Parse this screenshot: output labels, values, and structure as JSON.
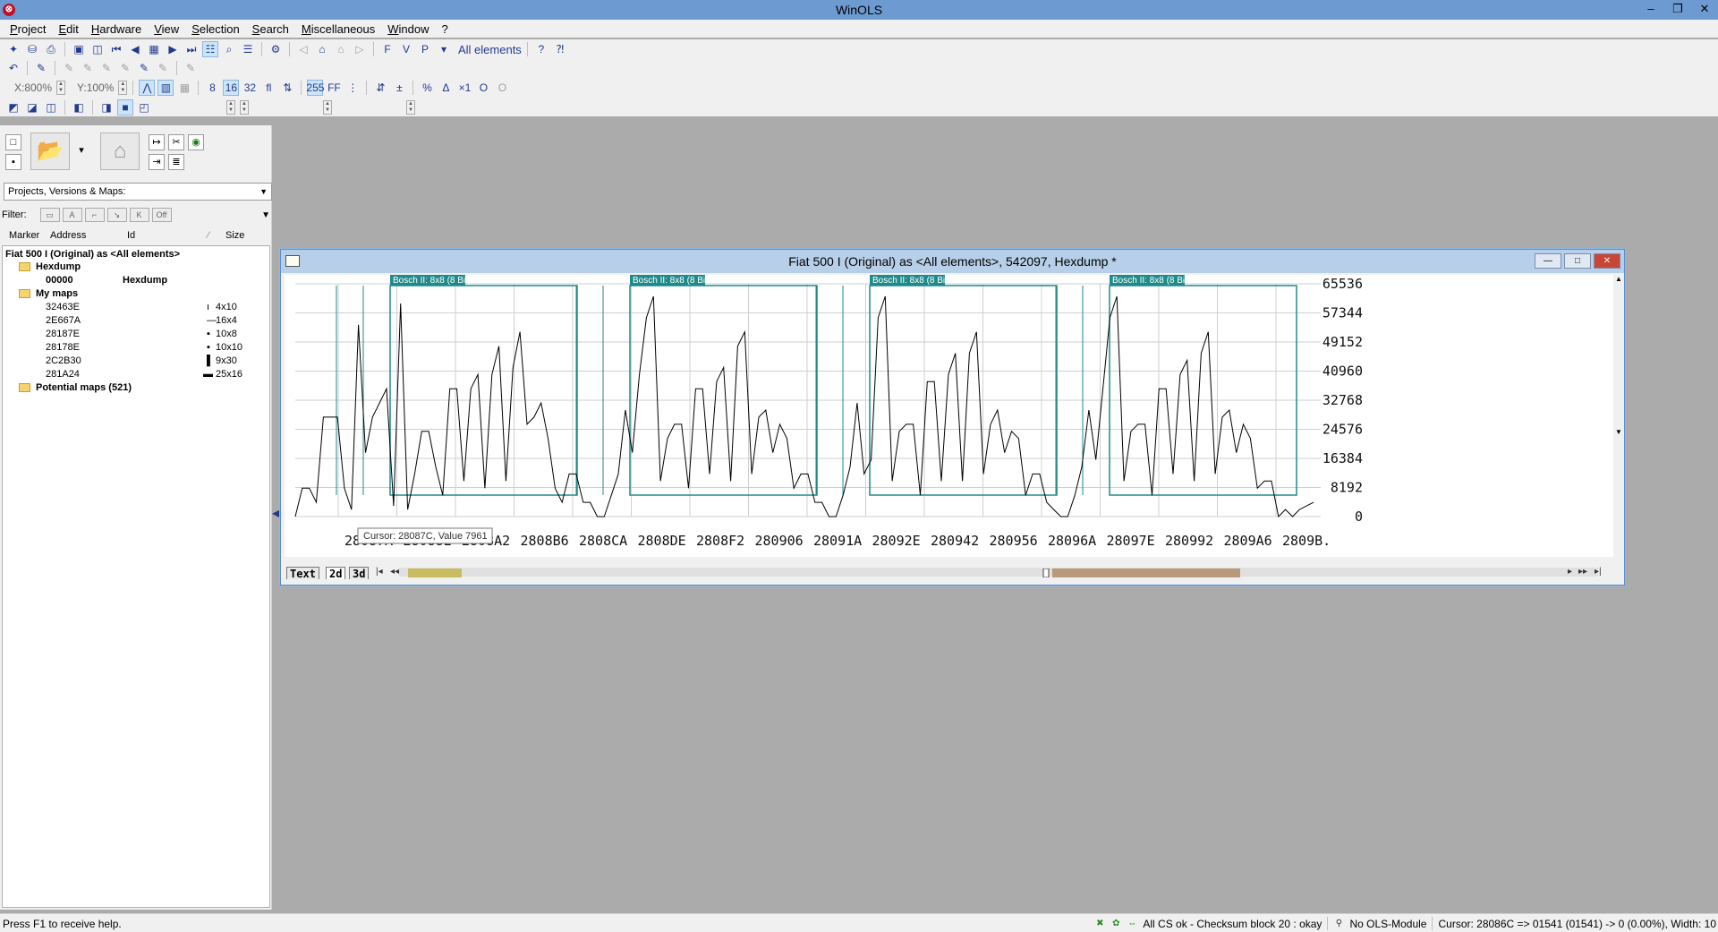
{
  "app": {
    "title": "WinOLS",
    "icon": "winols-logo-icon"
  },
  "menu": [
    "Project",
    "Edit",
    "Hardware",
    "View",
    "Selection",
    "Search",
    "Miscellaneous",
    "Window",
    "?"
  ],
  "toolbar": {
    "elements_label": "All elements",
    "zoom_x": "X:800%",
    "zoom_y": "Y:100%"
  },
  "left_panel": {
    "dropdown": "Projects, Versions & Maps:",
    "filter_label": "Filter:",
    "filter_off": "Off",
    "headers": {
      "marker": "Marker",
      "address": "Address",
      "id": "Id",
      "sort": "⁄",
      "size": "Size"
    },
    "tree": {
      "project": "Fiat 500 I (Original) as <All elements>",
      "hexdump_folder": "Hexdump",
      "hexdump_item": {
        "address": "00000",
        "id": "Hexdump"
      },
      "mymaps_folder": "My maps",
      "maps": [
        {
          "address": "32463E",
          "size": "4x10"
        },
        {
          "address": "2E667A",
          "size": "16x4"
        },
        {
          "address": "28187E",
          "size": "10x8"
        },
        {
          "address": "28178E",
          "size": "10x10"
        },
        {
          "address": "2C2B30",
          "size": "9x30"
        },
        {
          "address": "281A24",
          "size": "25x16"
        }
      ],
      "potential_folder": "Potential maps (521)"
    }
  },
  "hexdump_window": {
    "title": "Fiat 500 I (Original) as <All elements>, 542097, Hexdump *",
    "map_labels": [
      "Bosch II: 8x8 (8 Bit)",
      "Bosch II: 8x8 (8 Bit)",
      "Bosch II: 8x8 (8 Bit)",
      "Bosch II: 8x8 (8 Bit)"
    ],
    "tooltip": "Cursor: 28087C, Value 7961",
    "tabs": [
      "Text",
      "2d",
      "3d"
    ]
  },
  "chart_data": {
    "type": "line",
    "x_tick_labels": [
      "28087A",
      "28088E",
      "2808A2",
      "2808B6",
      "2808CA",
      "2808DE",
      "2808F2",
      "280906",
      "28091A",
      "28092E",
      "280942",
      "280956",
      "28096A",
      "28097E",
      "280992",
      "2809A6",
      "2809B."
    ],
    "y_tick_labels": [
      "65536",
      "57344",
      "49152",
      "40960",
      "32768",
      "24576",
      "16384",
      "8192",
      "0"
    ],
    "ylim": [
      0,
      65536
    ],
    "grid": true,
    "legend": "none",
    "series": [
      {
        "values": [
          0,
          8000,
          8000,
          4000,
          28000,
          28000,
          28000,
          8000,
          2000,
          54000,
          18000,
          28000,
          32000,
          36000,
          3000,
          60000,
          2000,
          12000,
          24000,
          24000,
          14000,
          6000,
          36000,
          36000,
          10000,
          36000,
          40000,
          8000,
          40000,
          48000,
          10000,
          42000,
          52000,
          26000,
          28000,
          32000,
          22000,
          8000,
          4000,
          12000,
          12000,
          4000,
          4000,
          0,
          0,
          6000,
          12000,
          30000,
          18000,
          40000,
          56000,
          62000,
          10000,
          22000,
          26000,
          26000,
          8000,
          36000,
          36000,
          12000,
          38000,
          42000,
          10000,
          48000,
          52000,
          12000,
          28000,
          30000,
          18000,
          26000,
          22000,
          8000,
          12000,
          12000,
          4000,
          4000,
          0,
          0,
          6000,
          14000,
          32000,
          12000,
          16000,
          56000,
          62000,
          10000,
          24000,
          26000,
          26000,
          6000,
          38000,
          38000,
          10000,
          40000,
          46000,
          10000,
          46000,
          52000,
          12000,
          26000,
          30000,
          18000,
          24000,
          22000,
          6000,
          12000,
          12000,
          4000,
          2000,
          0,
          0,
          6000,
          14000,
          30000,
          16000,
          36000,
          56000,
          62000,
          10000,
          24000,
          26000,
          26000,
          6000,
          36000,
          36000,
          12000,
          40000,
          44000,
          10000,
          46000,
          52000,
          12000,
          28000,
          30000,
          18000,
          26000,
          22000,
          8000,
          10000,
          10000,
          0,
          2000,
          0,
          2000,
          3000,
          4000
        ]
      }
    ]
  },
  "status": {
    "help": "Press F1 to receive help.",
    "checksum": "All CS ok - Checksum block 20 : okay",
    "module": "No OLS-Module",
    "cursor": "Cursor: 28086C => 01541 (01541) -> 0 (0.00%), Width: 10"
  },
  "colors": {
    "titlebar": "#6d9bd1",
    "map_frame": "#1f8a8a",
    "map_label_bg": "#1f8a8a",
    "mdi_background": "#ababab"
  }
}
